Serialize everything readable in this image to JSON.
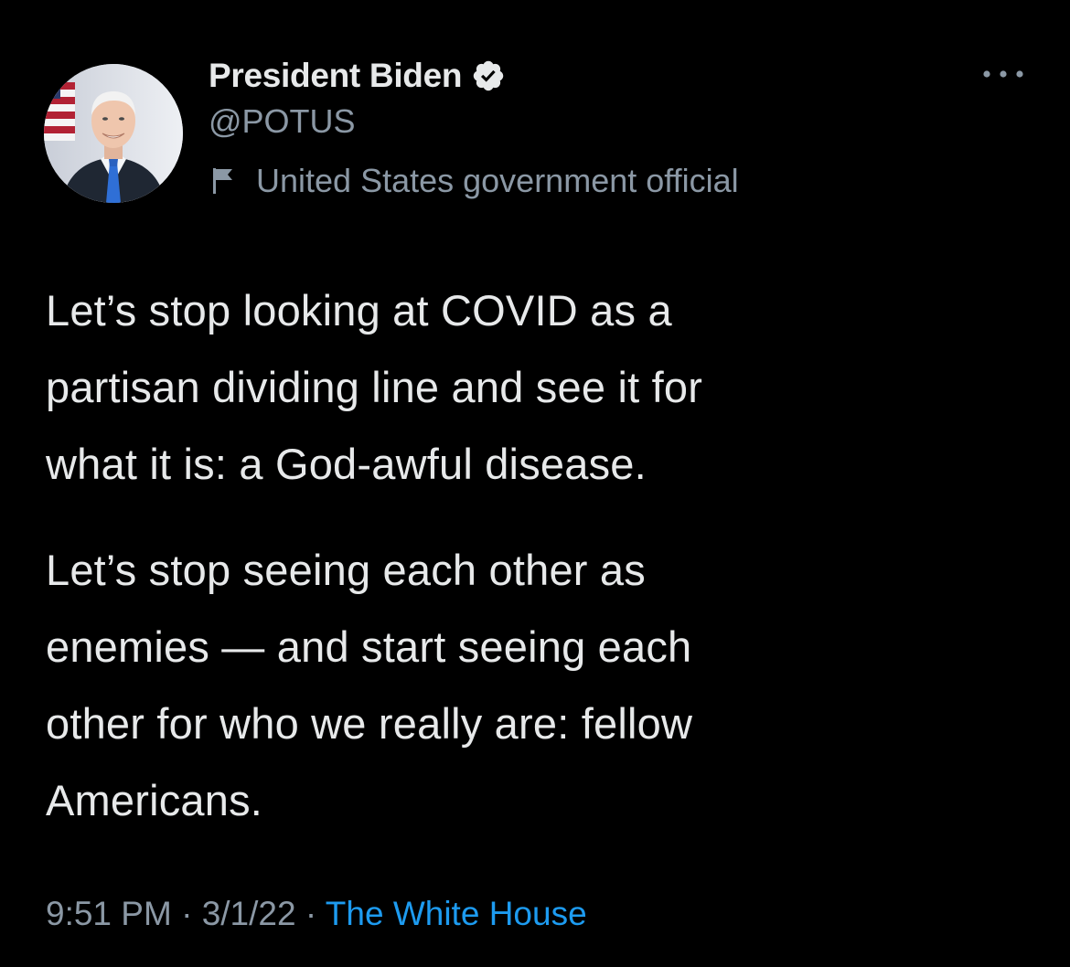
{
  "author": {
    "display_name": "President Biden",
    "handle": "@POTUS",
    "label": "United States government official",
    "verified": true
  },
  "tweet": {
    "paragraphs": [
      "Let’s stop looking at COVID as a\npartisan dividing line and see it for\nwhat it is: a God-awful disease.",
      "Let’s stop seeing each other as\nenemies — and start seeing each\nother for who we really are: fellow\nAmericans."
    ]
  },
  "meta": {
    "time": "9:51 PM",
    "separator": "·",
    "date": "3/1/22",
    "source": "The White House"
  },
  "icons": {
    "verified": "verified-badge-icon",
    "label": "flag-icon",
    "more": "more-options-icon"
  },
  "colors": {
    "background": "#000000",
    "primary_text": "#e7e9ea",
    "secondary_text": "#8b98a5",
    "link": "#1d9bf0"
  }
}
